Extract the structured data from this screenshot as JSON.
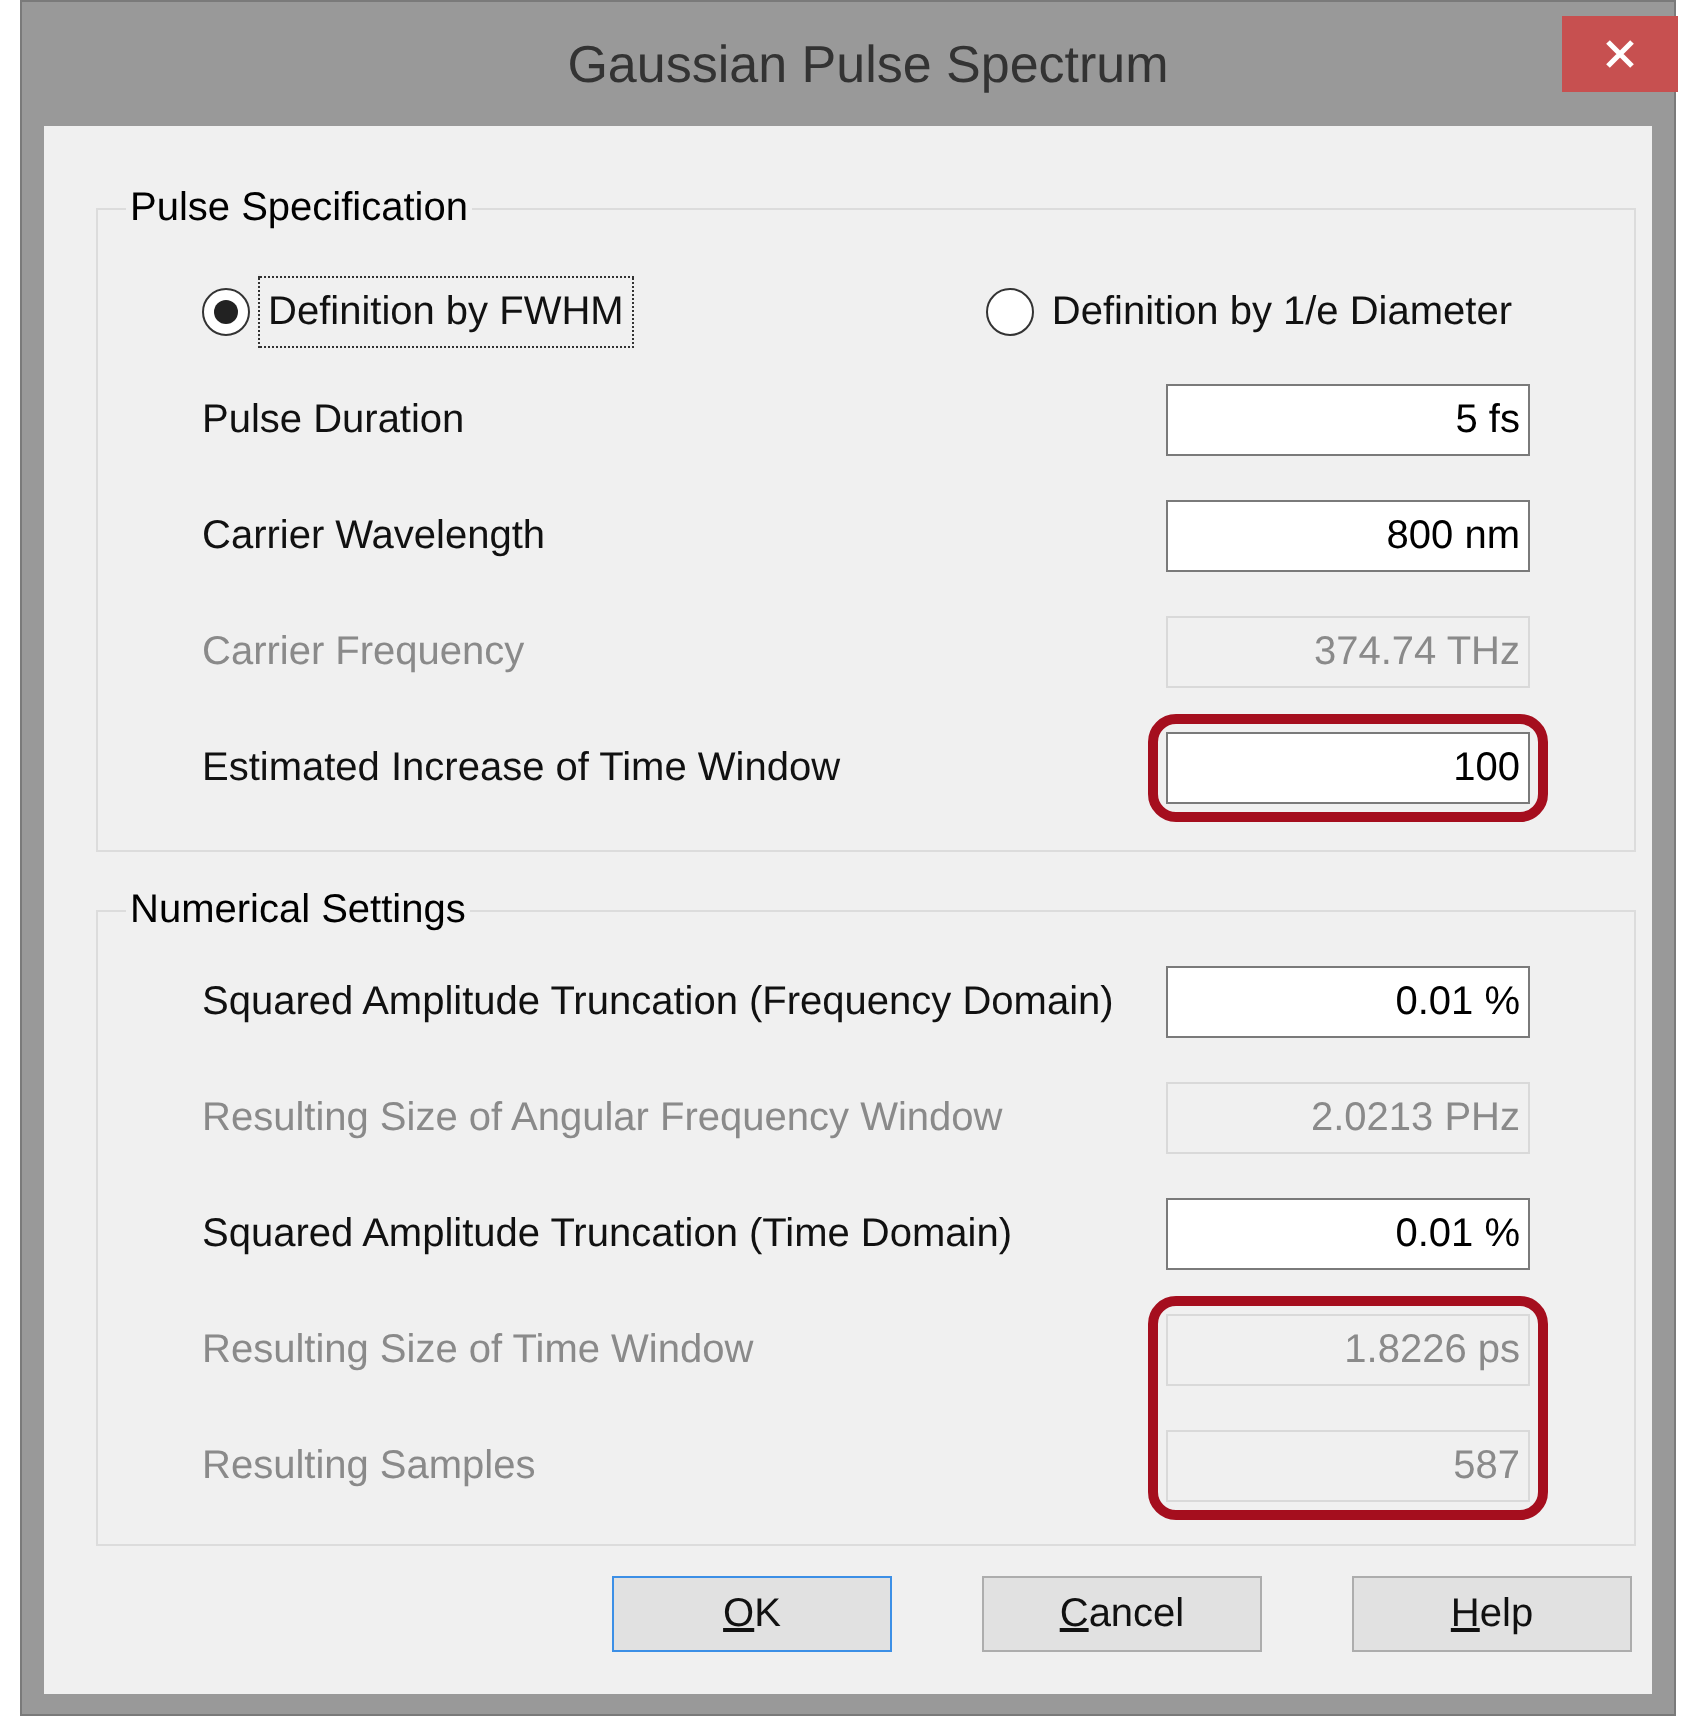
{
  "window": {
    "title": "Gaussian Pulse Spectrum"
  },
  "pulse_specification": {
    "title": "Pulse Specification",
    "definition_options": [
      {
        "label": "Definition by FWHM",
        "selected": true,
        "focused": true
      },
      {
        "label": "Definition by 1/e Diameter",
        "selected": false,
        "focused": false
      }
    ],
    "rows": [
      {
        "label": "Pulse Duration",
        "value": "5 fs",
        "disabled": false,
        "highlighted": false
      },
      {
        "label": "Carrier Wavelength",
        "value": "800 nm",
        "disabled": false,
        "highlighted": false
      },
      {
        "label": "Carrier Frequency",
        "value": "374.74 THz",
        "disabled": true,
        "highlighted": false
      },
      {
        "label": "Estimated Increase of Time Window",
        "value": "100",
        "disabled": false,
        "highlighted": true
      }
    ]
  },
  "numerical_settings": {
    "title": "Numerical Settings",
    "rows": [
      {
        "label": "Squared Amplitude Truncation (Frequency Domain)",
        "value": "0.01 %",
        "disabled": false,
        "highlighted": false
      },
      {
        "label": "Resulting Size of Angular Frequency Window",
        "value": "2.0213 PHz",
        "disabled": true,
        "highlighted": false
      },
      {
        "label": "Squared Amplitude Truncation (Time Domain)",
        "value": "0.01 %",
        "disabled": false,
        "highlighted": false
      },
      {
        "label": "Resulting Size of Time Window",
        "value": "1.8226 ps",
        "disabled": true,
        "highlighted": true
      },
      {
        "label": "Resulting Samples",
        "value": "587",
        "disabled": true,
        "highlighted": true
      }
    ]
  },
  "buttons": [
    {
      "label": "OK",
      "default": true
    },
    {
      "label": "Cancel",
      "default": false
    },
    {
      "label": "Help",
      "default": false
    }
  ]
}
